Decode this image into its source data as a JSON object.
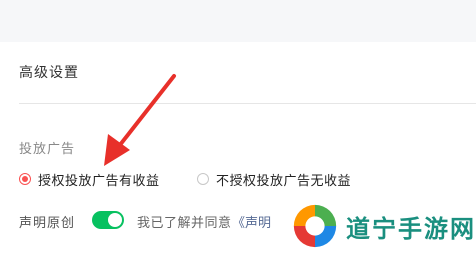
{
  "settings": {
    "section_title": "高级设置",
    "ad_label": "投放广告",
    "ad_options": [
      {
        "label": "授权投放广告有收益",
        "selected": true
      },
      {
        "label": "不授权投放广告无收益",
        "selected": false
      }
    ],
    "declare_label": "声明原创",
    "declare_toggle_on": true,
    "agree_text": "我已了解并同意",
    "agree_link": "《声明"
  },
  "watermark": {
    "text": "道宁手游网",
    "logo_icon": "swirl-logo-icon"
  },
  "colors": {
    "accent_red": "#fa5151",
    "toggle_green": "#07c160",
    "link_blue": "#576b95",
    "watermark_teal": "#1a8f7f"
  }
}
